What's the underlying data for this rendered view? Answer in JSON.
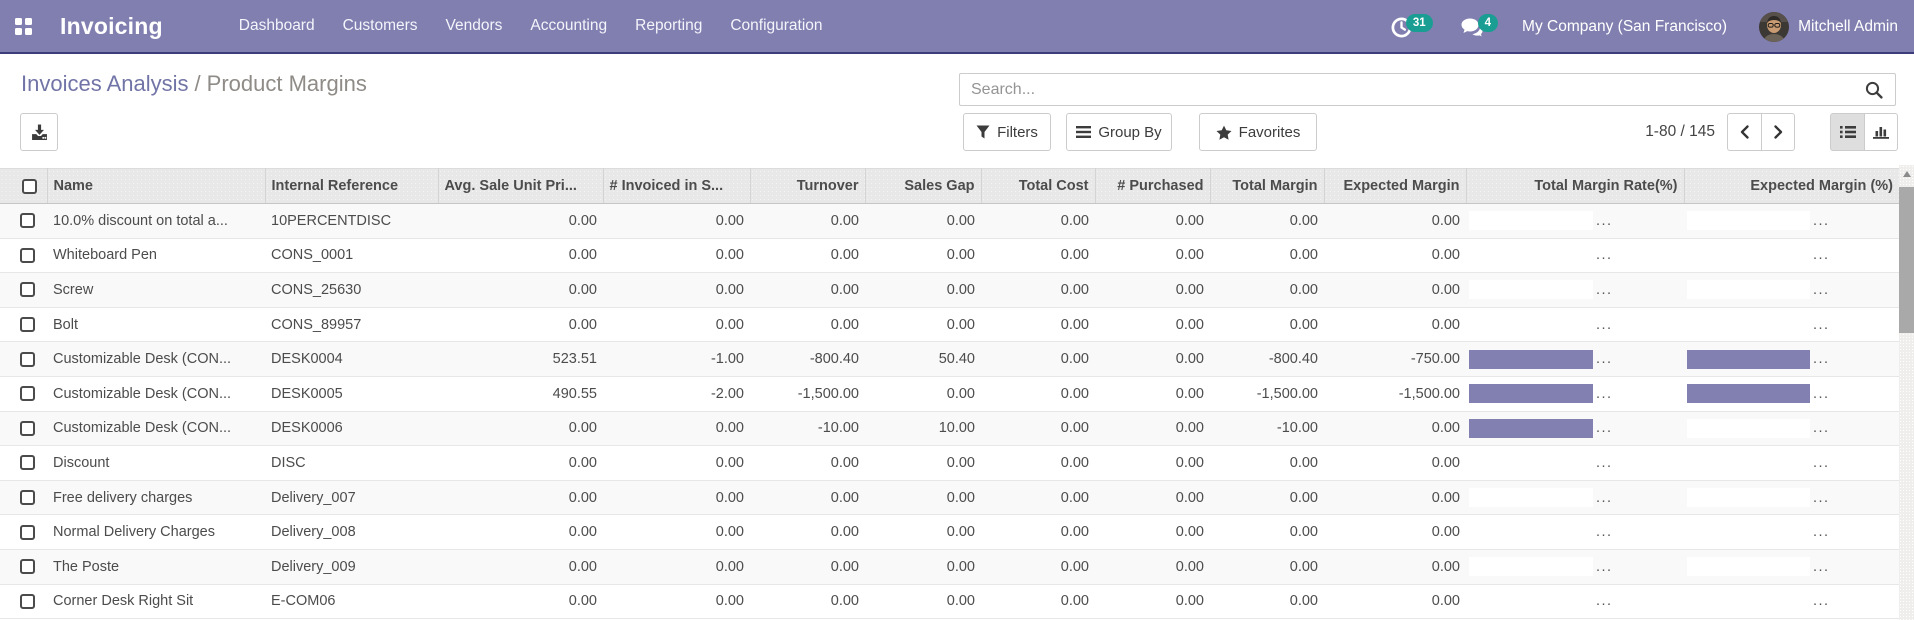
{
  "navbar": {
    "app_name": "Invoicing",
    "menu_items": [
      "Dashboard",
      "Customers",
      "Vendors",
      "Accounting",
      "Reporting",
      "Configuration"
    ],
    "activities_badge": "31",
    "messages_badge": "4",
    "company": "My Company (San Francisco)",
    "user": "Mitchell Admin",
    "colors": {
      "background": "#817fb0",
      "badge": "#1a9e93"
    }
  },
  "breadcrumb": {
    "parent": "Invoices Analysis",
    "separator": "/",
    "current": "Product Margins"
  },
  "search": {
    "placeholder": "Search..."
  },
  "controls": {
    "filters_label": "Filters",
    "groupby_label": "Group By",
    "favorites_label": "Favorites",
    "pager_value": "1-80 / 145"
  },
  "table": {
    "columns": [
      {
        "label": "Name",
        "align": "left"
      },
      {
        "label": "Internal Reference",
        "align": "left"
      },
      {
        "label": "Avg. Sale Unit Pri...",
        "align": "left"
      },
      {
        "label": "# Invoiced in S...",
        "align": "left"
      },
      {
        "label": "Turnover",
        "align": "right"
      },
      {
        "label": "Sales Gap",
        "align": "right"
      },
      {
        "label": "Total Cost",
        "align": "right"
      },
      {
        "label": "# Purchased",
        "align": "right"
      },
      {
        "label": "Total Margin",
        "align": "right"
      },
      {
        "label": "Expected Margin",
        "align": "right"
      },
      {
        "label": "Total Margin Rate(%)",
        "align": "right"
      },
      {
        "label": "Expected Margin (%)",
        "align": "right"
      }
    ],
    "ellipsis": "...",
    "bar_color": "#8180b1",
    "rows": [
      {
        "name": "10.0% discount on total a...",
        "ref": "10PERCENTDISC",
        "avg_sale": "0.00",
        "invoiced": "0.00",
        "turnover": "0.00",
        "sales_gap": "0.00",
        "total_cost": "0.00",
        "purchased": "0.00",
        "total_margin": "0.00",
        "expected_margin": "0.00",
        "margin_rate_bar": "empty",
        "expected_rate_bar": "empty"
      },
      {
        "name": "Whiteboard Pen",
        "ref": "CONS_0001",
        "avg_sale": "0.00",
        "invoiced": "0.00",
        "turnover": "0.00",
        "sales_gap": "0.00",
        "total_cost": "0.00",
        "purchased": "0.00",
        "total_margin": "0.00",
        "expected_margin": "0.00",
        "margin_rate_bar": "empty",
        "expected_rate_bar": "empty"
      },
      {
        "name": "Screw",
        "ref": "CONS_25630",
        "avg_sale": "0.00",
        "invoiced": "0.00",
        "turnover": "0.00",
        "sales_gap": "0.00",
        "total_cost": "0.00",
        "purchased": "0.00",
        "total_margin": "0.00",
        "expected_margin": "0.00",
        "margin_rate_bar": "empty",
        "expected_rate_bar": "empty"
      },
      {
        "name": "Bolt",
        "ref": "CONS_89957",
        "avg_sale": "0.00",
        "invoiced": "0.00",
        "turnover": "0.00",
        "sales_gap": "0.00",
        "total_cost": "0.00",
        "purchased": "0.00",
        "total_margin": "0.00",
        "expected_margin": "0.00",
        "margin_rate_bar": "empty",
        "expected_rate_bar": "empty"
      },
      {
        "name": "Customizable Desk (CON...",
        "ref": "DESK0004",
        "avg_sale": "523.51",
        "invoiced": "-1.00",
        "turnover": "-800.40",
        "sales_gap": "50.40",
        "total_cost": "0.00",
        "purchased": "0.00",
        "total_margin": "-800.40",
        "expected_margin": "-750.00",
        "margin_rate_bar": "filled",
        "expected_rate_bar": "filled"
      },
      {
        "name": "Customizable Desk (CON...",
        "ref": "DESK0005",
        "avg_sale": "490.55",
        "invoiced": "-2.00",
        "turnover": "-1,500.00",
        "sales_gap": "0.00",
        "total_cost": "0.00",
        "purchased": "0.00",
        "total_margin": "-1,500.00",
        "expected_margin": "-1,500.00",
        "margin_rate_bar": "filled",
        "expected_rate_bar": "filled"
      },
      {
        "name": "Customizable Desk (CON...",
        "ref": "DESK0006",
        "avg_sale": "0.00",
        "invoiced": "0.00",
        "turnover": "-10.00",
        "sales_gap": "10.00",
        "total_cost": "0.00",
        "purchased": "0.00",
        "total_margin": "-10.00",
        "expected_margin": "0.00",
        "margin_rate_bar": "filled",
        "expected_rate_bar": "empty"
      },
      {
        "name": "Discount",
        "ref": "DISC",
        "avg_sale": "0.00",
        "invoiced": "0.00",
        "turnover": "0.00",
        "sales_gap": "0.00",
        "total_cost": "0.00",
        "purchased": "0.00",
        "total_margin": "0.00",
        "expected_margin": "0.00",
        "margin_rate_bar": "empty",
        "expected_rate_bar": "empty"
      },
      {
        "name": "Free delivery charges",
        "ref": "Delivery_007",
        "avg_sale": "0.00",
        "invoiced": "0.00",
        "turnover": "0.00",
        "sales_gap": "0.00",
        "total_cost": "0.00",
        "purchased": "0.00",
        "total_margin": "0.00",
        "expected_margin": "0.00",
        "margin_rate_bar": "empty",
        "expected_rate_bar": "empty"
      },
      {
        "name": "Normal Delivery Charges",
        "ref": "Delivery_008",
        "avg_sale": "0.00",
        "invoiced": "0.00",
        "turnover": "0.00",
        "sales_gap": "0.00",
        "total_cost": "0.00",
        "purchased": "0.00",
        "total_margin": "0.00",
        "expected_margin": "0.00",
        "margin_rate_bar": "empty",
        "expected_rate_bar": "empty"
      },
      {
        "name": "The Poste",
        "ref": "Delivery_009",
        "avg_sale": "0.00",
        "invoiced": "0.00",
        "turnover": "0.00",
        "sales_gap": "0.00",
        "total_cost": "0.00",
        "purchased": "0.00",
        "total_margin": "0.00",
        "expected_margin": "0.00",
        "margin_rate_bar": "empty",
        "expected_rate_bar": "empty"
      },
      {
        "name": "Corner Desk Right Sit",
        "ref": "E-COM06",
        "avg_sale": "0.00",
        "invoiced": "0.00",
        "turnover": "0.00",
        "sales_gap": "0.00",
        "total_cost": "0.00",
        "purchased": "0.00",
        "total_margin": "0.00",
        "expected_margin": "0.00",
        "margin_rate_bar": "empty",
        "expected_rate_bar": "empty"
      }
    ]
  }
}
